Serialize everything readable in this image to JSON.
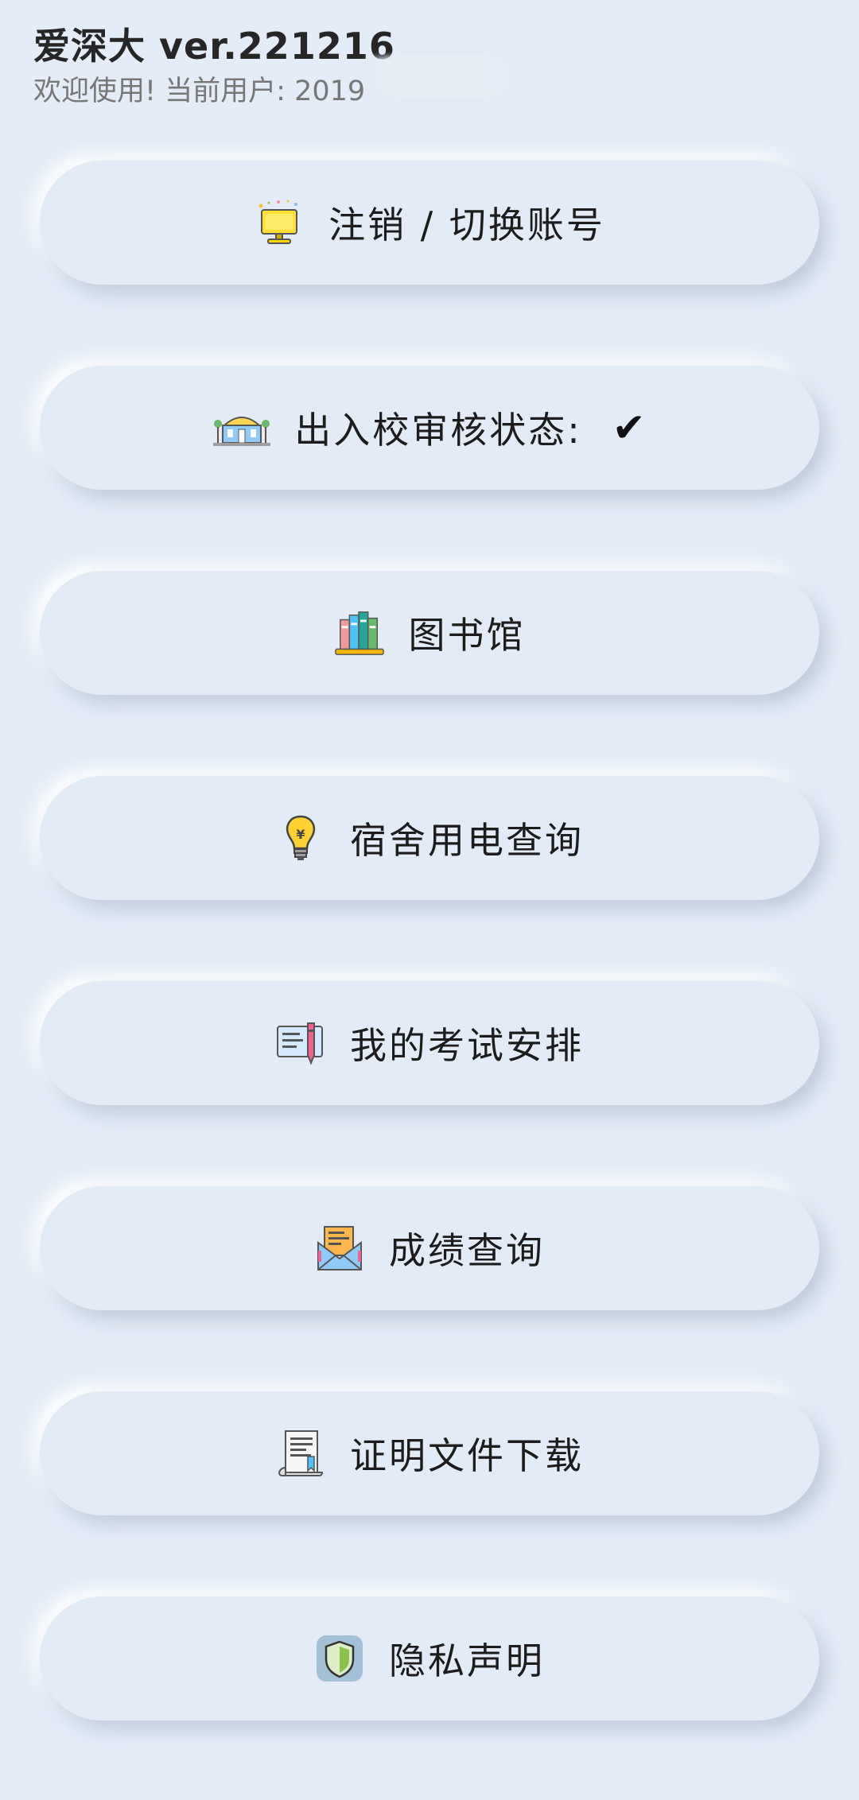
{
  "header": {
    "title": "爱深大 ver.221216",
    "subtitle": "欢迎使用! 当前用户: 2019"
  },
  "menu": [
    {
      "label": "注销 / 切换账号",
      "icon": "monitor-icon"
    },
    {
      "label": "出入校审核状态:",
      "icon": "campus-gate-icon",
      "status": "✔"
    },
    {
      "label": "图书馆",
      "icon": "books-icon"
    },
    {
      "label": "宿舍用电查询",
      "icon": "lightbulb-icon"
    },
    {
      "label": "我的考试安排",
      "icon": "exam-pen-icon"
    },
    {
      "label": "成绩查询",
      "icon": "envelope-icon"
    },
    {
      "label": "证明文件下载",
      "icon": "document-icon"
    },
    {
      "label": "隐私声明",
      "icon": "shield-icon"
    }
  ]
}
